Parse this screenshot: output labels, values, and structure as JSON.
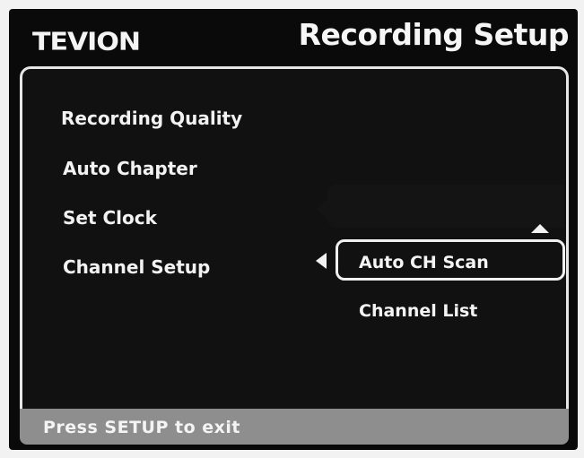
{
  "header": {
    "logo": "TEVION",
    "title": "Recording Setup"
  },
  "menu": {
    "items": [
      {
        "label": "Recording Quality"
      },
      {
        "label": "Auto Chapter"
      },
      {
        "label": "Set Clock"
      },
      {
        "label": "Channel Setup"
      }
    ]
  },
  "submenu": {
    "items": [
      {
        "label": "Auto CH Scan"
      },
      {
        "label": "Channel List",
        "selected": true
      }
    ]
  },
  "footer": {
    "hint": "Press SETUP to exit"
  }
}
